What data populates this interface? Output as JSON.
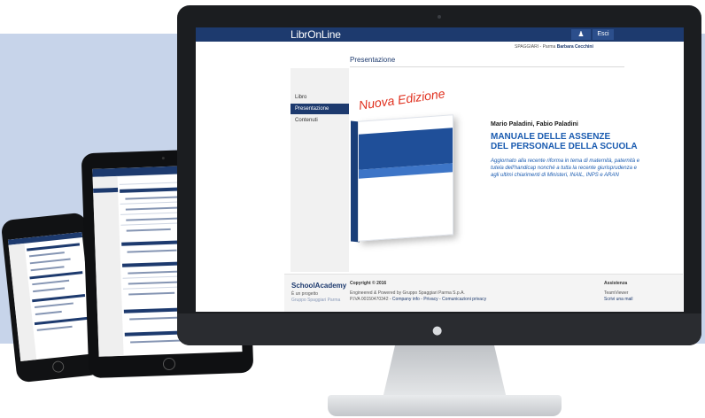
{
  "imac": {
    "site": {
      "logo": "LibrOnLine",
      "user_icon": "user-icon",
      "exit_label": "Esci",
      "user_line_prefix": "SPAGGIARI - Parma",
      "user_name": "Barbara Cecchini",
      "page_title": "Presentazione",
      "menu": [
        {
          "label": "Libro",
          "active": false
        },
        {
          "label": "Presentazione",
          "active": true
        },
        {
          "label": "Contenuti",
          "active": false
        }
      ],
      "book": {
        "caption": "Nuova Edizione",
        "authors": "Mario Paladini, Fabio Paladini",
        "title_line1": "MANUALE DELLE ASSENZE",
        "title_line2": "DEL PERSONALE DELLA SCUOLA",
        "description": "Aggiornato alla recente riforma in tema di maternità, paternità e tutela dell'handicap nonché a tutta la recente giurisprudenza e agli ultimi chiarimenti di Ministeri, INAIL, INPS e ARAN"
      },
      "footer": {
        "brand": "SchoolAcademy",
        "project_label": "È un progetto",
        "group_label": "Gruppo Spaggiari Parma",
        "copyright": "Copyright © 2016",
        "engineered": "Engineered & Powered by Gruppo Spaggiari Parma S.p.A.",
        "vat": "P.IVA 00150470342 -",
        "links": "Company info - Privacy - Comunicazioni privacy",
        "help_title": "Assistenza",
        "help_item1": "TeamViewer",
        "help_item2": "Scrivi una mail"
      }
    }
  },
  "colors": {
    "brand_navy": "#1d3a6e",
    "title_blue": "#1a5bb0",
    "caption_red": "#e0301e",
    "background_panel": "#c7d4ea"
  }
}
